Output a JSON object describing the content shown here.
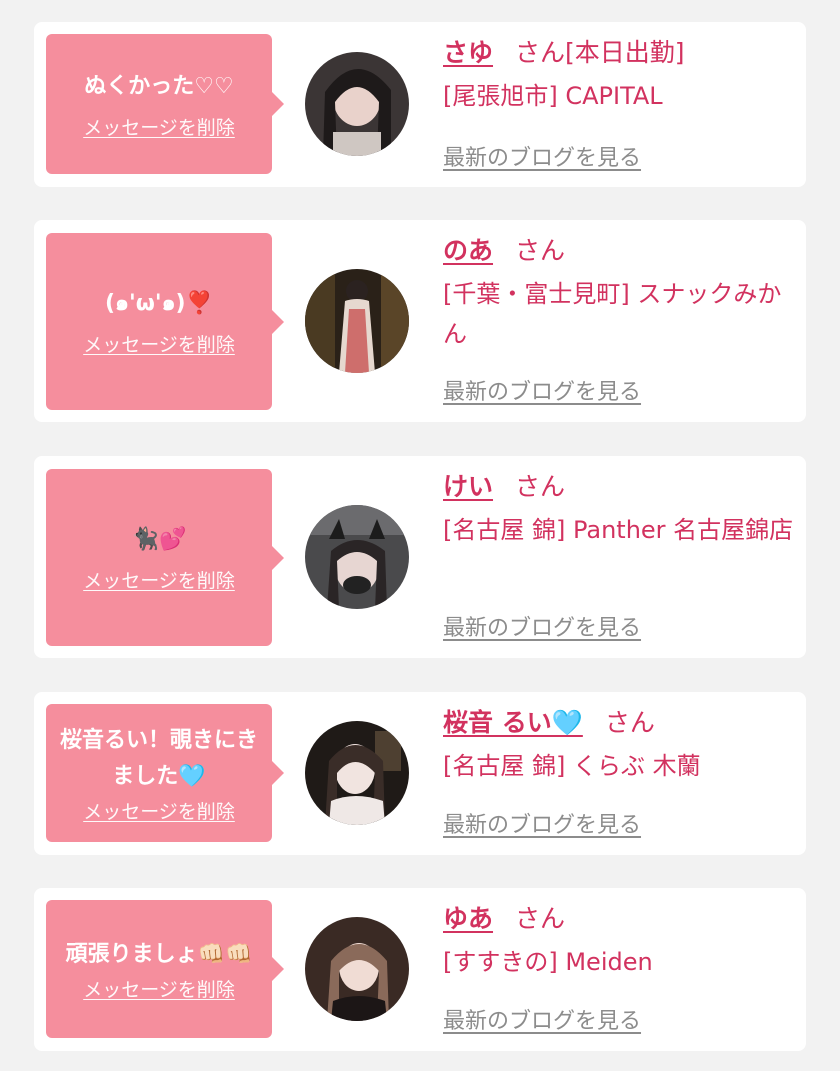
{
  "colors": {
    "background": "#f2f2f2",
    "card": "#ffffff",
    "bubble": "#f58e9d",
    "accent": "#d2325f",
    "muted": "#8c8c8c"
  },
  "common": {
    "delete_label": "メッセージを削除",
    "blog_label": "最新のブログを見る",
    "honorific": "さん"
  },
  "items": [
    {
      "message": "ぬくかった♡♡",
      "name": "さゆ",
      "status": "[本日出勤]",
      "shop": "[尾張旭市] CAPITAL",
      "avatar_icon": "avatar-photo"
    },
    {
      "message": "(๑'ω'๑)❣️",
      "name": "のあ",
      "status": "",
      "shop": "[千葉・富士見町] スナックみかん",
      "avatar_icon": "avatar-photo"
    },
    {
      "message": "🐈‍⬛💕",
      "name": "けい",
      "status": "",
      "shop": "[名古屋 錦] Panther 名古屋錦店",
      "avatar_icon": "avatar-photo"
    },
    {
      "message": "桜音るい！覗きにきました🩵",
      "name": "桜音 るい🩵",
      "status": "",
      "shop": "[名古屋 錦] くらぶ 木蘭",
      "avatar_icon": "avatar-photo"
    },
    {
      "message": "頑張りましょ👊🏻👊🏻",
      "name": "ゆあ",
      "status": "",
      "shop": "[すすきの] Meiden",
      "avatar_icon": "avatar-photo"
    }
  ]
}
